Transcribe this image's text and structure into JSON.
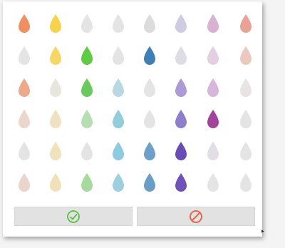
{
  "palette": {
    "columns": [
      {
        "name": "orange",
        "color": "#ec8a5a"
      },
      {
        "name": "yellow",
        "color": "#f8cf45"
      },
      {
        "name": "green",
        "color": "#5fcb45"
      },
      {
        "name": "cyan",
        "color": "#8dc9dc"
      },
      {
        "name": "blue",
        "color": "#3f7fb6"
      },
      {
        "name": "purple",
        "color": "#6a4db4"
      },
      {
        "name": "magenta",
        "color": "#a3449a"
      },
      {
        "name": "salmon",
        "color": "#e68c7e"
      }
    ],
    "cells": [
      [
        "#ee9060",
        "#f7d24c",
        "#e4e4e4",
        "#e4e4e4",
        "#dcdcdc",
        "#d0cbe2",
        "#d7b2d2",
        "#eaa294"
      ],
      [
        "#e4e4e4",
        "#f6d766",
        "#5fcb45",
        "#e4e4e4",
        "#3f7fb6",
        "#dddde6",
        "#e3cfe1",
        "#ecc9bf"
      ],
      [
        "#eca98b",
        "#e8e6dc",
        "#6ac95c",
        "#b8d9e2",
        "#e4e4e4",
        "#ac9ad6",
        "#d8b6d9",
        "#e8e4e4"
      ],
      [
        "#ebd6cb",
        "#f0e2c0",
        "#b5dfb2",
        "#93cddc",
        "#e4e4e4",
        "#8f7fcb",
        "#a3449a",
        "#e4e4e4"
      ],
      [
        "#e4e4e4",
        "#efe2bc",
        "#e4e4e4",
        "#8fcbe0",
        "#6d9fc8",
        "#6a4db4",
        "#e3dde6",
        "#e4e4e4"
      ],
      [
        "#ebd4cc",
        "#f1e0b8",
        "#a7d99c",
        "#9dcfdf",
        "#6a9ec4",
        "#6f52ba",
        "#e4e4e4",
        "#e4e4e4"
      ]
    ]
  },
  "buttons": {
    "confirm": {
      "icon": "gauge-check-icon",
      "color": "#5dbd46"
    },
    "cancel": {
      "icon": "no-entry-icon",
      "color": "#e06a4d"
    }
  }
}
